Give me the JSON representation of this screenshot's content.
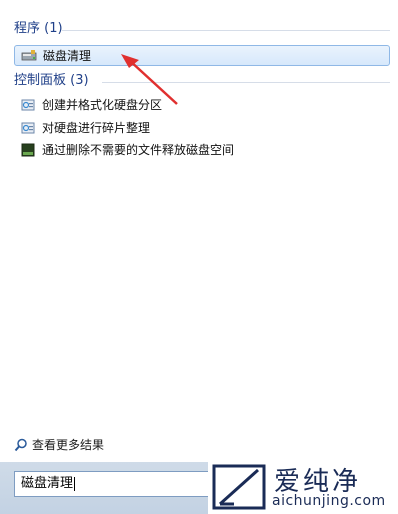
{
  "sections": {
    "programs": {
      "header": "程序 (1)",
      "items": [
        {
          "label": "磁盘清理",
          "icon": "disk-cleanup-icon"
        }
      ]
    },
    "control_panel": {
      "header": "控制面板 (3)",
      "items": [
        {
          "label": "创建并格式化硬盘分区",
          "icon": "control-panel-icon"
        },
        {
          "label": "对硬盘进行碎片整理",
          "icon": "control-panel-icon"
        },
        {
          "label": "通过删除不需要的文件释放磁盘空间",
          "icon": "disk-space-icon"
        }
      ]
    }
  },
  "see_more": {
    "label": "查看更多结果",
    "icon": "search-icon"
  },
  "search": {
    "value": "磁盘清理"
  },
  "watermark": {
    "text": "爱纯净",
    "url": "aichunjing.com"
  },
  "colors": {
    "header": "#1f3f88",
    "highlight_border": "#8fb8e6",
    "arrow": "#e0302f"
  }
}
